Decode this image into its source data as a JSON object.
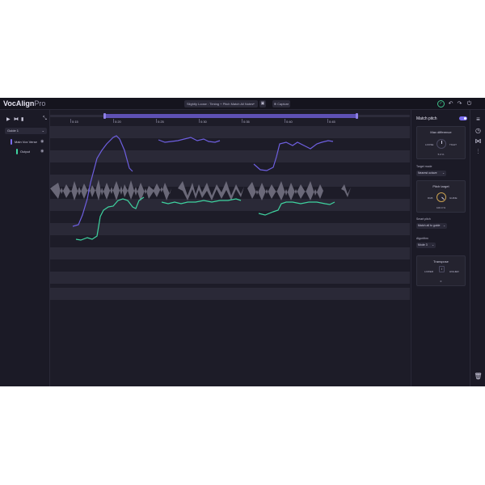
{
  "app": {
    "name": "VocAlign",
    "edition": "Pro"
  },
  "toolbar": {
    "preset": "Slightly Loose : Timing + Pitch Match All Notes",
    "capture_label": "⊕ Capture"
  },
  "left_panel": {
    "guide_select": "Guide 1",
    "tracks": [
      {
        "label": "Main Vox Verse",
        "color": "#7a6df0"
      },
      {
        "label": "Output",
        "color": "#3fd3a0"
      }
    ]
  },
  "timeline": {
    "ticks": [
      "0:15",
      "0:20",
      "0:25",
      "0:30",
      "0:35",
      "0:40",
      "0:45"
    ],
    "guide_color": "#6e5fe0",
    "output_color": "#3fd3a0"
  },
  "right_panel": {
    "title": "Match pitch",
    "enabled": true,
    "max_difference": {
      "title": "Max difference",
      "loose": "LOOSE",
      "tight": "TIGHT",
      "value": "5.0 %"
    },
    "target_mode": {
      "label": "Target mode",
      "value": "Nearest octave"
    },
    "pitch_target": {
      "title": "Pitch target",
      "low": "DUB",
      "high": "GUIDE",
      "value": "100.0 %"
    },
    "smart_pitch": {
      "label": "Smart pitch",
      "value": "Match all to guide"
    },
    "algorithm": {
      "label": "Algorithm",
      "value": "Mode 3"
    },
    "transpose": {
      "title": "Transpose",
      "lower": "LOWER",
      "higher": "HIGHER",
      "value": "0"
    }
  },
  "rail_icons": [
    "menu-icon",
    "history-icon",
    "align-icon",
    "mixer-icon",
    "trash-icon"
  ]
}
